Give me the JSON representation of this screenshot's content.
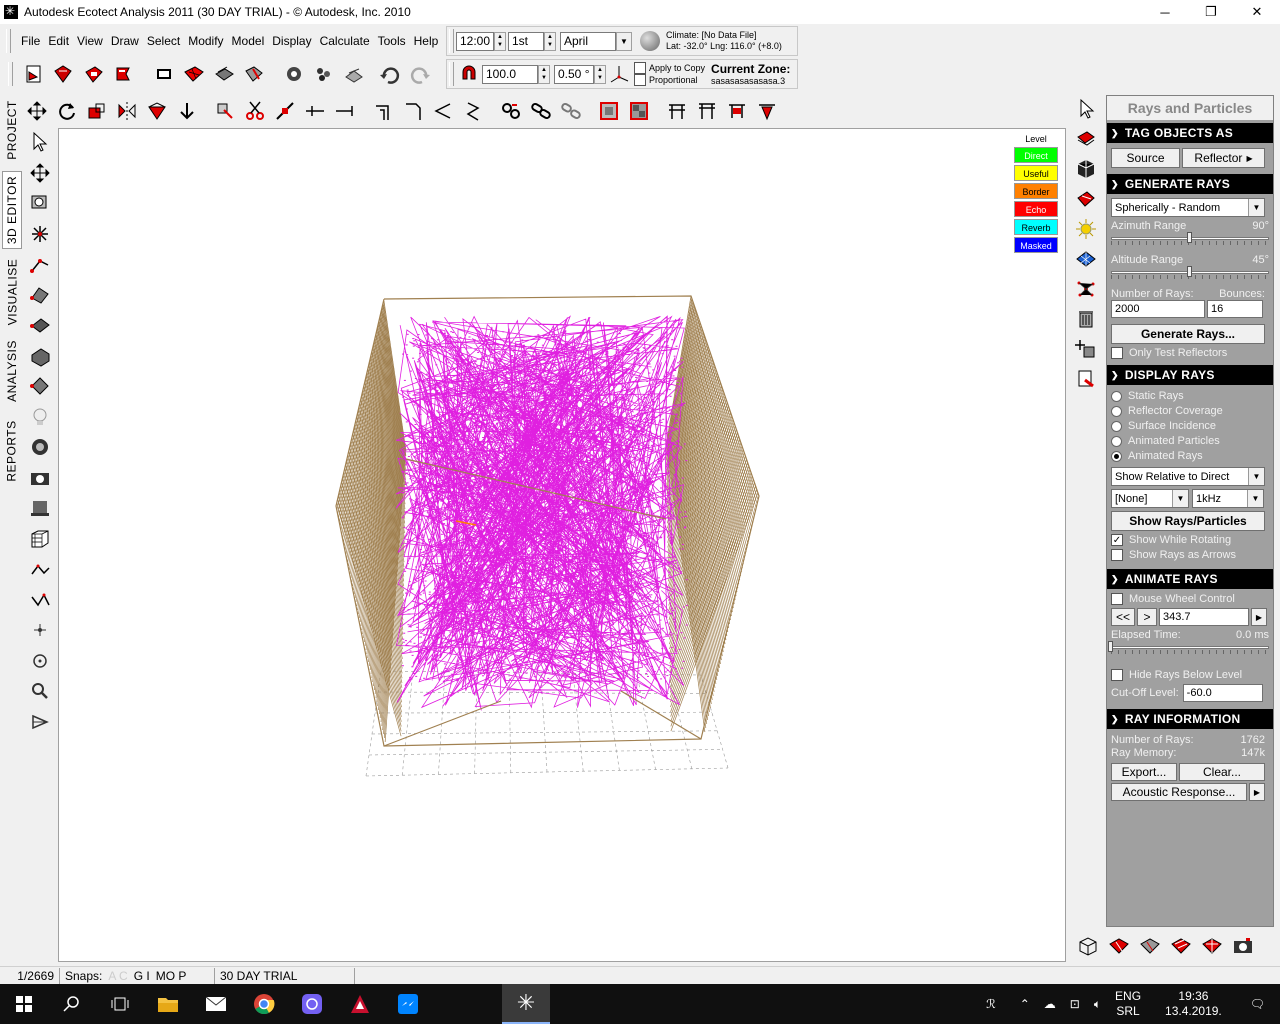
{
  "window": {
    "title": "Autodesk Ecotect Analysis 2011 (30 DAY TRIAL) - © Autodesk, Inc. 2010",
    "minimize": "─",
    "maximize": "❐",
    "close": "✕"
  },
  "menu": [
    "File",
    "Edit",
    "View",
    "Draw",
    "Select",
    "Modify",
    "Model",
    "Display",
    "Calculate",
    "Tools",
    "Help"
  ],
  "time_controls": {
    "time": "12:00",
    "day": "1st",
    "month": "April",
    "climate": "Climate: [No Data File]",
    "location": "Lat: -32.0°   Lng: 116.0° (+8.0)"
  },
  "snap_controls": {
    "scale": "100.0",
    "step": "0.50 °",
    "apply_to_copy": "Apply to Copy",
    "proportional": "Proportional",
    "current_zone_label": "Current Zone:",
    "current_zone_value": "sasasasasasasa.3"
  },
  "side_tabs": [
    "PROJECT",
    "3D EDITOR",
    "VISUALISE",
    "ANALYSIS",
    "REPORTS"
  ],
  "legend": {
    "title": "Level",
    "items": [
      {
        "label": "Direct",
        "color": "#00ff00",
        "text": "#ffffff"
      },
      {
        "label": "Useful",
        "color": "#ffff00",
        "text": "#000000"
      },
      {
        "label": "Border",
        "color": "#ff8000",
        "text": "#000000"
      },
      {
        "label": "Echo",
        "color": "#ff0000",
        "text": "#ffffff"
      },
      {
        "label": "Reverb",
        "color": "#00ffff",
        "text": "#000000"
      },
      {
        "label": "Masked",
        "color": "#0000ff",
        "text": "#ffffff"
      }
    ]
  },
  "panel": {
    "title": "Rays and Particles",
    "tag": {
      "heading": "TAG OBJECTS AS",
      "source": "Source",
      "reflector": "Reflector"
    },
    "generate": {
      "heading": "GENERATE RAYS",
      "mode": "Spherically - Random",
      "azimuth_label": "Azimuth Range",
      "azimuth_value": "90°",
      "azimuth_fraction": 0.5,
      "altitude_label": "Altitude Range",
      "altitude_value": "45°",
      "altitude_fraction": 0.5,
      "num_rays_label": "Number of Rays:",
      "bounces_label": "Bounces:",
      "num_rays": "2000",
      "bounces": "16",
      "generate_button": "Generate Rays...",
      "only_test_reflectors": "Only Test Reflectors"
    },
    "display": {
      "heading": "DISPLAY RAYS",
      "options": [
        "Static Rays",
        "Reflector Coverage",
        "Surface Incidence",
        "Animated Particles",
        "Animated Rays"
      ],
      "selected": "Animated Rays",
      "relative": "Show Relative to Direct",
      "band_filter": "[None]",
      "frequency": "1kHz",
      "show_button": "Show Rays/Particles",
      "show_while_rotating": "Show While Rotating",
      "show_as_arrows": "Show Rays as Arrows"
    },
    "animate": {
      "heading": "ANIMATE RAYS",
      "mouse_wheel": "Mouse Wheel Control",
      "prev": "<<",
      "next": ">",
      "value": "343.7",
      "play": "▶",
      "elapsed_label": "Elapsed Time:",
      "elapsed_value": "0.0 ms",
      "elapsed_fraction": 0,
      "hide_below": "Hide Rays Below Level",
      "cutoff_label": "Cut-Off Level:",
      "cutoff_value": "-60.0"
    },
    "info": {
      "heading": "RAY INFORMATION",
      "num_rays_label": "Number of Rays:",
      "num_rays_value": "1762",
      "memory_label": "Ray Memory:",
      "memory_value": "147k",
      "export": "Export...",
      "clear": "Clear...",
      "acoustic": "Acoustic Response..."
    }
  },
  "status": {
    "count": "1/2669",
    "snaps_label": "Snaps:",
    "snaps_a": "G I",
    "snaps_b": "MO P",
    "trial": "30 DAY TRIAL"
  },
  "taskbar": {
    "lang": "ENG",
    "region": "SRL",
    "time": "19:36",
    "date": "13.4.2019."
  }
}
